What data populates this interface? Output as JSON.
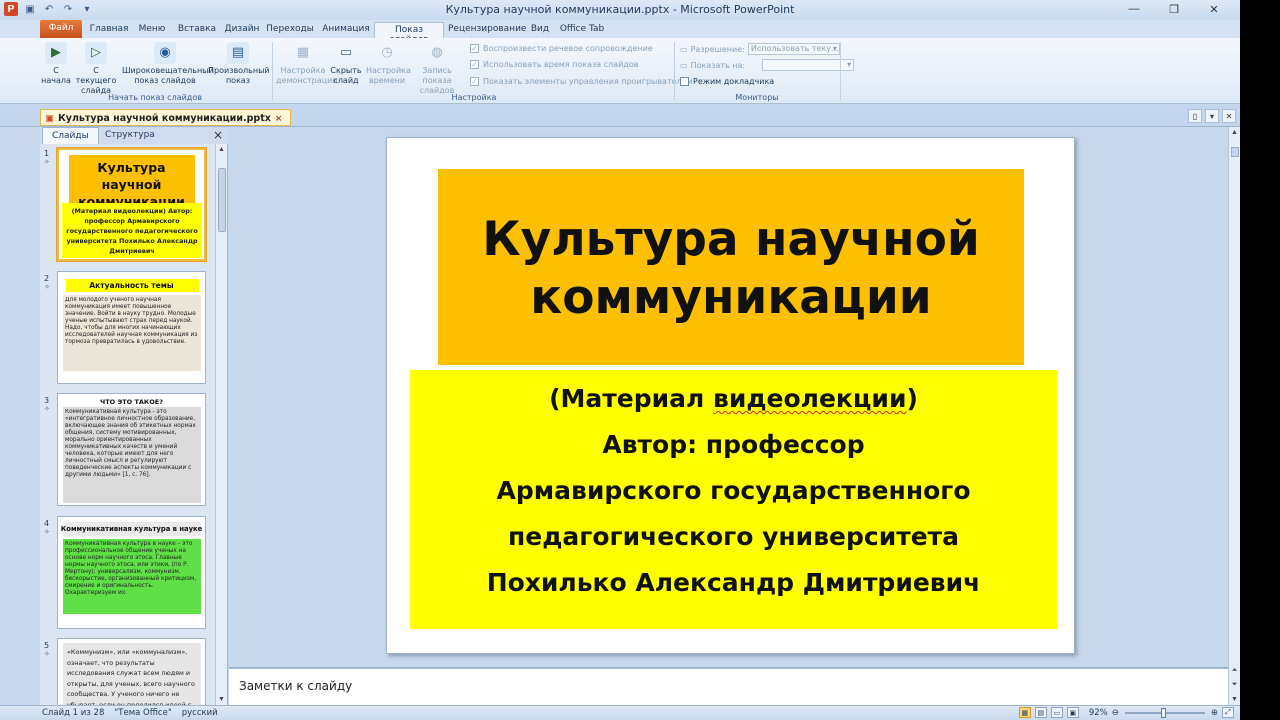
{
  "window": {
    "title": "Культура научной коммуникации.pptx - Microsoft PowerPoint",
    "app_logo": "P"
  },
  "ribbon_tabs": [
    "Файл",
    "Главная",
    "Меню",
    "Вставка",
    "Дизайн",
    "Переходы",
    "Анимация",
    "Показ слайдов",
    "Рецензирование",
    "Вид",
    "Office Tab"
  ],
  "ribbon": {
    "start_show": {
      "from_start": "С начала",
      "from_current": "С текущего слайда",
      "broadcast": "Широковещательный показ слайдов",
      "custom": "Произвольный показ",
      "group_label": "Начать показ слайдов"
    },
    "setup": {
      "setup_show": "Настройка демонстрации",
      "hide_slide": "Скрыть слайд",
      "rehearse": "Настройка времени",
      "record": "Запись показа слайдов",
      "play_narrations": "Воспроизвести речевое сопровождение",
      "use_timings": "Использовать время показа слайдов",
      "show_controls": "Показать элементы управления проигрывателем",
      "group_label": "Настройка"
    },
    "monitors": {
      "resolution_label": "Разрешение:",
      "resolution_value": "Использовать теку...",
      "show_on_label": "Показать на:",
      "show_on_value": "",
      "presenter_view": "Режим докладчика",
      "group_label": "Мониторы"
    }
  },
  "document_tab": {
    "name": "Культура научной коммуникации.pptx",
    "close": "×"
  },
  "left_pane": {
    "tab_slides": "Слайды",
    "tab_outline": "Структура",
    "close": "×",
    "thumbnails": [
      {
        "num": "1",
        "title": "Культура научной коммуникации",
        "body": "(Материал видеолекции) Автор: профессор Армавирского государственного педагогического университета Похилько Александр Дмитриевич"
      },
      {
        "num": "2",
        "title": "Актуальность темы",
        "body": "Для молодого ученого научная коммуникация имеет повышенное значение. Войти в науку трудно. Молодые ученые испытывают страх перед наукой. Надо, чтобы для многих начинающих исследователей научная коммуникация из тормоза превратилась в удовольствие."
      },
      {
        "num": "3",
        "title": "ЧТО ЭТО ТАКОЕ?",
        "body": "Коммуникативная культура - это «интегративное личностное образование, включающее знания об этикетных нормах общения, систему мотивированных, морально ориентированных коммуникативных качеств и умений человека, которые имеют для него личностный смысл и регулируют поведенческие аспекты коммуникации с другими людьми» [1, с. 76]."
      },
      {
        "num": "4",
        "title": "Коммуникативная культура в науке",
        "body": "Коммуникативная культура в науке – это профессиональное общение ученых на основе норм научного этоса. Главные нормы научного этоса, или этики, (по Р. Мертону): универсализм, коммунизм, бескорыстие, организованный критицизм, смирение и оригинальность. Охарактеризуем их."
      },
      {
        "num": "5",
        "title": "",
        "body": "«Коммунизм», или «коммунализм», означает, что результаты исследования служат всем людям и открыты, для ученых, всего научного сообщества. У ученого ничего не убывает, если он поделился идеей с"
      }
    ]
  },
  "slide": {
    "title_line1": "Культура научной",
    "title_line2": "коммуникации",
    "sub_line1_a": "(Материал ",
    "sub_line1_b": "видеолекции",
    "sub_line1_c": ")",
    "sub_line2": "Автор: профессор",
    "sub_line3": "Армавирского государственного",
    "sub_line4": "педагогического университета",
    "sub_line5": "Похилько Александр Дмитриевич"
  },
  "notes": {
    "placeholder": "Заметки к слайду"
  },
  "status_bar": {
    "slide_info": "Слайд 1 из 28",
    "theme": "\"Тема Office\"",
    "language": "русский",
    "zoom": "92%"
  },
  "colors": {
    "title_fill": "#fdc000",
    "subtitle_fill": "#ffff00",
    "file_tab": "#d9622b",
    "selected_thumb_border": "#f0b945"
  }
}
